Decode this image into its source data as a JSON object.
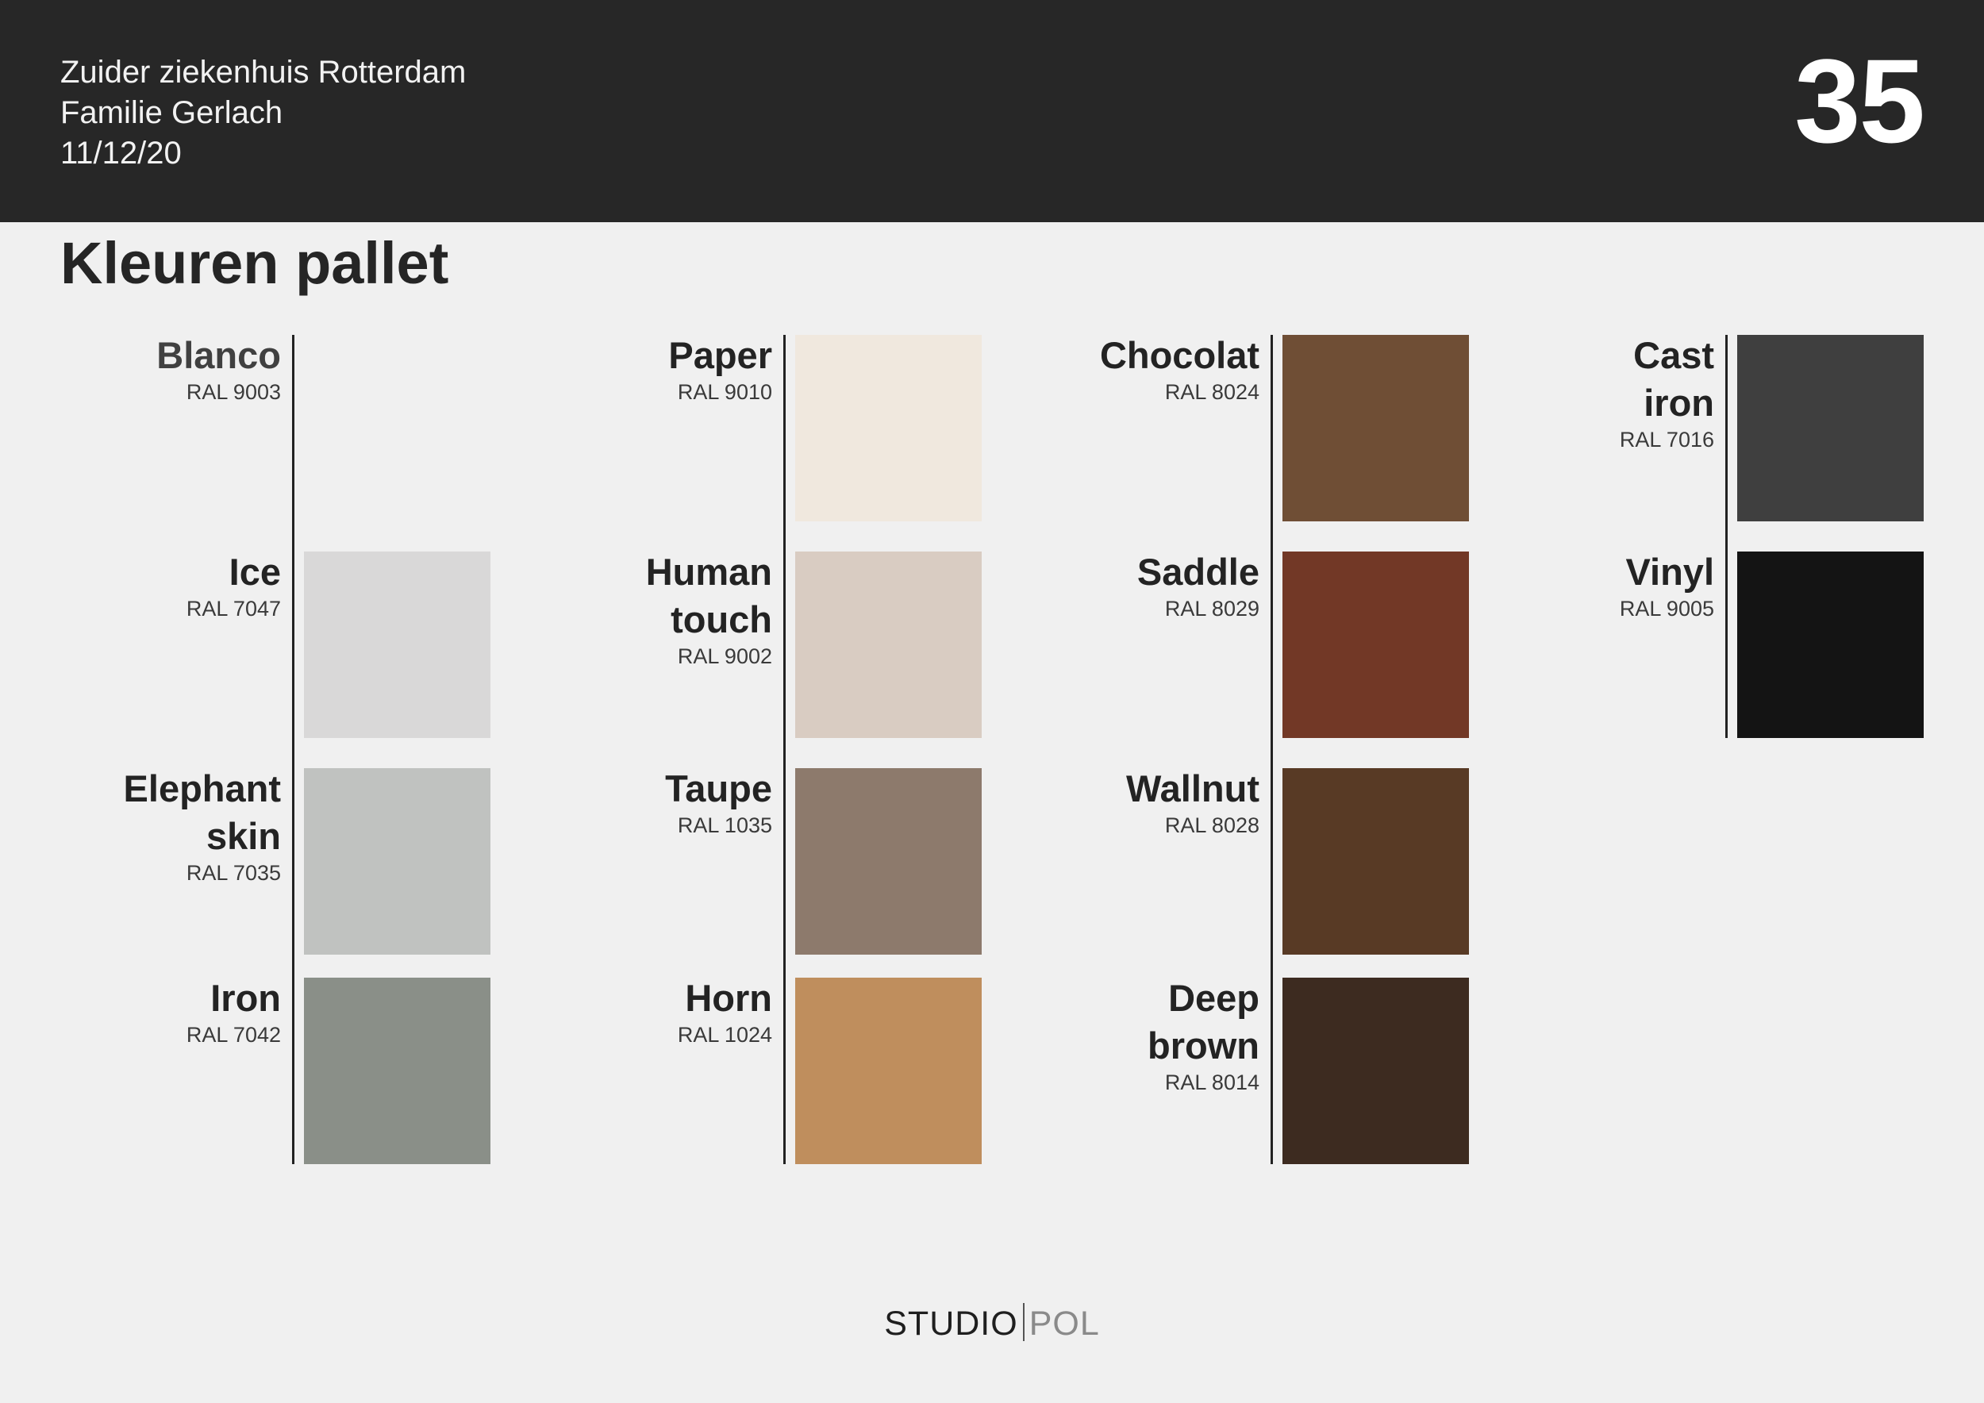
{
  "header": {
    "project": "Zuider ziekenhuis Rotterdam",
    "client": "Familie Gerlach",
    "date": "11/12/20",
    "page_number": "35"
  },
  "title": "Kleuren pallet",
  "columns": [
    {
      "swatches": [
        {
          "name_lines": [
            "Blanco"
          ],
          "code": "RAL 9003",
          "color": "#f0f0f0",
          "name_color": "#404040"
        },
        {
          "name_lines": [
            "Ice"
          ],
          "code": "RAL 7047",
          "color": "#d9d8d8"
        },
        {
          "name_lines": [
            "Elephant",
            "skin"
          ],
          "code": "RAL 7035",
          "color": "#c0c2c0"
        },
        {
          "name_lines": [
            "Iron"
          ],
          "code": "RAL 7042",
          "color": "#8a8f88"
        }
      ]
    },
    {
      "swatches": [
        {
          "name_lines": [
            "Paper"
          ],
          "code": "RAL 9010",
          "color": "#f0e8de"
        },
        {
          "name_lines": [
            "Human",
            "touch"
          ],
          "code": "RAL 9002",
          "color": "#d9ccc2"
        },
        {
          "name_lines": [
            "Taupe"
          ],
          "code": "RAL 1035",
          "color": "#8d7a6c"
        },
        {
          "name_lines": [
            "Horn"
          ],
          "code": "RAL 1024",
          "color": "#bf8e5d"
        }
      ]
    },
    {
      "swatches": [
        {
          "name_lines": [
            "Chocolat"
          ],
          "code": "RAL 8024",
          "color": "#6f4e35"
        },
        {
          "name_lines": [
            "Saddle"
          ],
          "code": "RAL 8029",
          "color": "#723826"
        },
        {
          "name_lines": [
            "Wallnut"
          ],
          "code": "RAL 8028",
          "color": "#583a25"
        },
        {
          "name_lines": [
            "Deep",
            "brown"
          ],
          "code": "RAL 8014",
          "color": "#3d2b20"
        }
      ]
    },
    {
      "swatches": [
        {
          "name_lines": [
            "Cast",
            "iron"
          ],
          "code": "RAL 7016",
          "color": "#3f3f3f"
        },
        {
          "name_lines": [
            "Vinyl"
          ],
          "code": "RAL 9005",
          "color": "#141414"
        }
      ]
    }
  ],
  "footer": {
    "logo_studio": "STUDIO",
    "logo_pol": "POL"
  }
}
